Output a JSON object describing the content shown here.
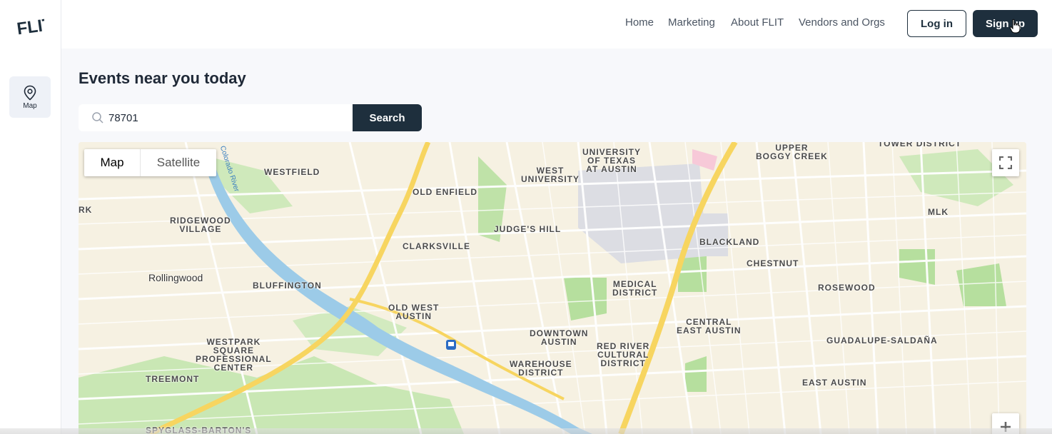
{
  "brand": {
    "logo_text": "FLIT"
  },
  "sidebar": {
    "items": [
      {
        "label": "Map",
        "icon": "map-pin-icon"
      }
    ]
  },
  "header": {
    "nav": [
      "Home",
      "Marketing",
      "About FLIT",
      "Vendors and Orgs"
    ],
    "login_label": "Log in",
    "signup_label": "Sign up"
  },
  "main": {
    "title": "Events near you today",
    "search": {
      "value": "78701",
      "button_label": "Search"
    }
  },
  "map": {
    "type_buttons": [
      "Map",
      "Satellite"
    ],
    "active_type": "Map",
    "labels": {
      "westfield": "WESTFIELD",
      "old_enfield": "OLD ENFIELD",
      "ut_austin": "UNIVERSITY\nOF TEXAS\nAT AUSTIN",
      "west_university": "WEST\nUNIVERSITY",
      "upper_boggy_creek": "UPPER\nBOGGY CREEK",
      "tower_district": "TOWER DISTRICT",
      "rk": "RK",
      "ridgewood_village": "RIDGEWOOD\nVILLAGE",
      "judges_hill": "JUDGE'S HILL",
      "clarksville": "CLARKSVILLE",
      "mlk": "MLK",
      "blackland": "BLACKLAND",
      "chestnut": "CHESTNUT",
      "rollingwood": "Rollingwood",
      "bluffington": "BLUFFINGTON",
      "medical_district": "MEDICAL\nDISTRICT",
      "rosewood": "ROSEWOOD",
      "old_west_austin": "OLD WEST\nAUSTIN",
      "central_east_austin": "CENTRAL\nEAST AUSTIN",
      "downtown_austin": "DOWNTOWN\nAUSTIN",
      "guadalupe_saldana": "GUADALUPE-SALDAÑA",
      "westpark": "WESTPARK\nSQUARE\nPROFESSIONAL\nCENTER",
      "red_river": "RED RIVER\nCULTURAL\nDISTRICT",
      "warehouse_district": "WAREHOUSE\nDISTRICT",
      "treemont": "TREEMONT",
      "east_austin": "EAST AUSTIN",
      "spyglass": "SPYGLASS-BARTON'S",
      "colorado_river": "Colorado River"
    }
  }
}
